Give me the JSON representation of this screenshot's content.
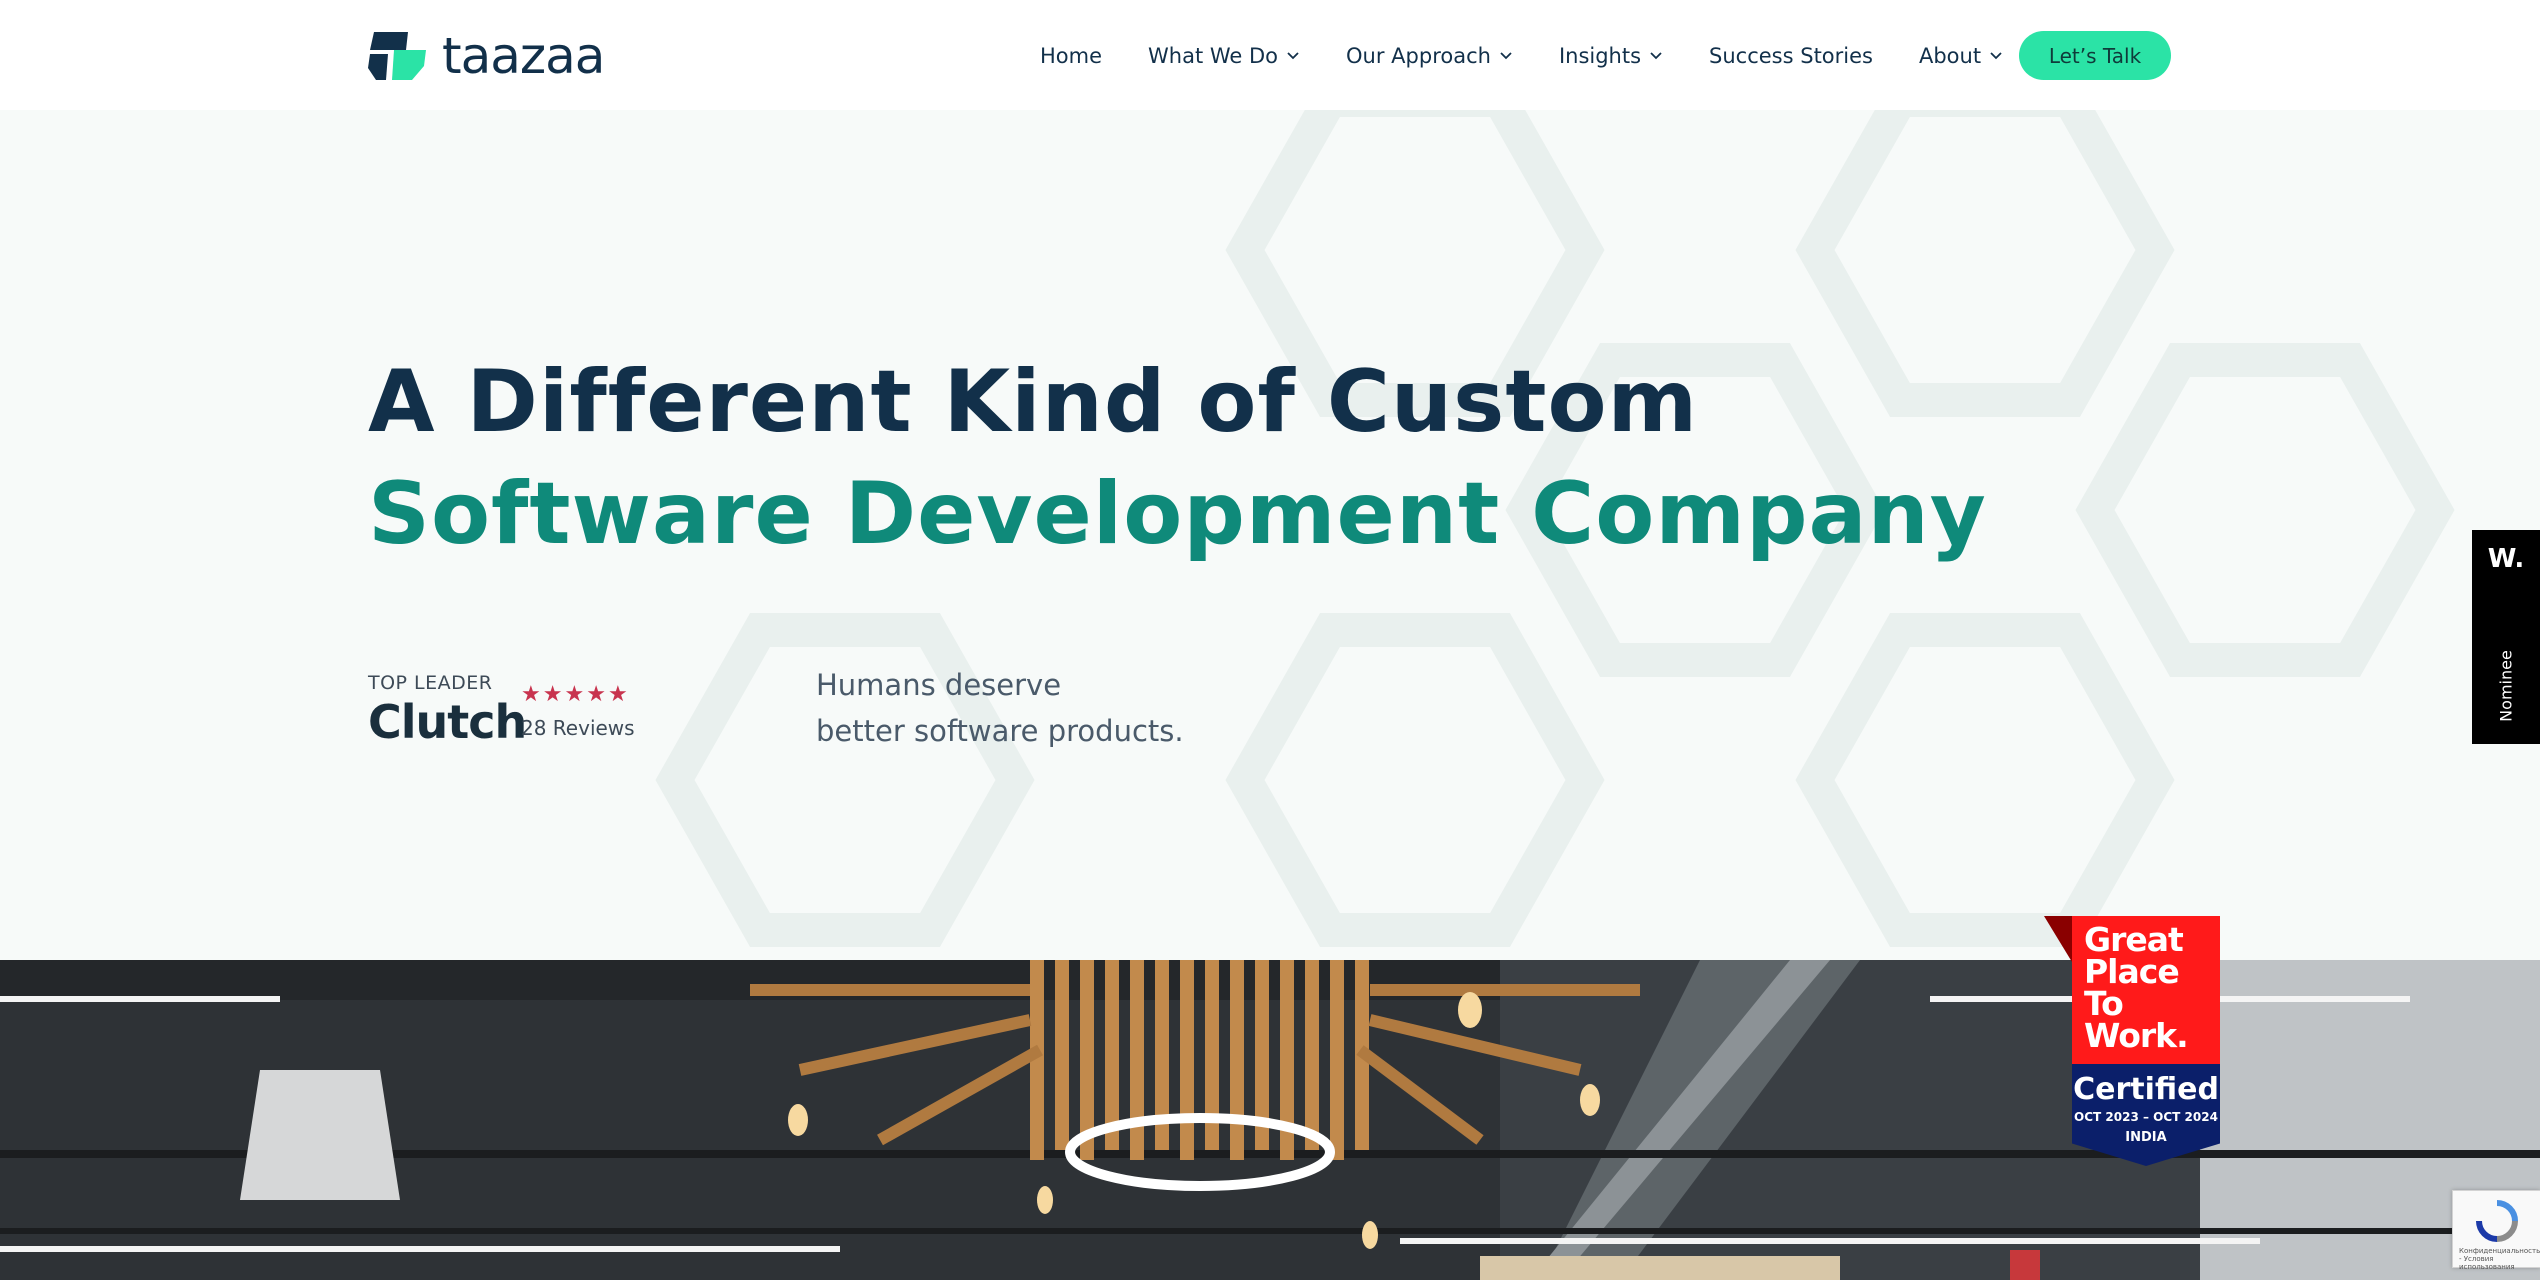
{
  "header": {
    "logo_text": "taazaa",
    "nav": [
      {
        "label": "Home",
        "has_dropdown": false
      },
      {
        "label": "What We Do",
        "has_dropdown": true
      },
      {
        "label": "Our Approach",
        "has_dropdown": true
      },
      {
        "label": "Insights",
        "has_dropdown": true
      },
      {
        "label": "Success Stories",
        "has_dropdown": false
      },
      {
        "label": "About",
        "has_dropdown": true
      }
    ],
    "cta_label": "Let’s Talk"
  },
  "hero": {
    "headline_line1": "A Different Kind of Custom",
    "headline_line2": "Software Development Company",
    "clutch": {
      "kicker": "TOP LEADER",
      "brand": "Clutch",
      "rating_stars": 5,
      "reviews": "28 Reviews"
    },
    "tagline_line1": "Humans deserve",
    "tagline_line2": "better software products."
  },
  "side_badge": {
    "logo": "W.",
    "label": "Nominee"
  },
  "gptw_badge": {
    "line1": "Great",
    "line2": "Place",
    "line3": "To",
    "line4": "Work.",
    "certified": "Certified",
    "dates": "OCT 2023 – OCT 2024",
    "country": "INDIA"
  },
  "recaptcha": {
    "legal": "Конфиденциальность - Условия использования"
  },
  "colors": {
    "navy": "#12304a",
    "teal": "#0f8a7a",
    "cta_green": "#2be3a6",
    "star_red": "#c8344f"
  },
  "icons": {
    "dropdown": "chevron-down-icon",
    "logo": "taazaa-logo-icon"
  }
}
